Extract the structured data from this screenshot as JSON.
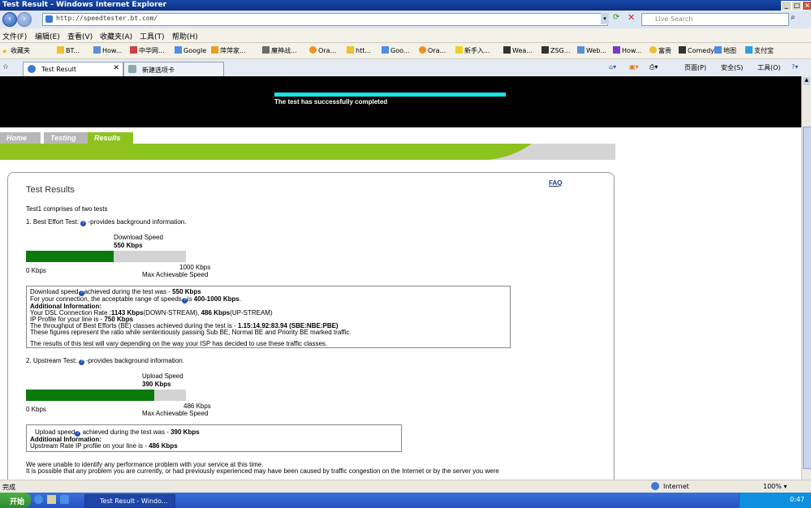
{
  "window": {
    "title": "Test Result - Windows Internet Explorer"
  },
  "addressbar": {
    "url": "http://speedtester.bt.com/",
    "search_placeholder": "Live Search"
  },
  "menu": [
    "文件(F)",
    "编辑(E)",
    "查看(V)",
    "收藏夹(A)",
    "工具(T)",
    "帮助(H)"
  ],
  "favorites": {
    "label": "收藏夹",
    "items": [
      "BT...",
      "How...",
      "中华网...",
      "Google",
      "萍萍家...",
      "魔神战...",
      "htt...",
      "Goo...",
      "Ora...",
      "htt...",
      "Goo...",
      "Ora...",
      "新手入...",
      "Wea...",
      "ZSG...",
      "Web...",
      "How...",
      "富贵",
      "Comedy",
      "地图",
      "支付宝"
    ]
  },
  "tabs": {
    "active": "Test Result",
    "new": "新建选项卡"
  },
  "toolbar": {
    "page": "页面(P)",
    "safety": "安全(S)",
    "tools": "工具(O)"
  },
  "page": {
    "progress_text": "The test has successfully completed",
    "nav": [
      {
        "label": "Home",
        "color": "#b7b7b7"
      },
      {
        "label": "Testing",
        "color": "#b7b7b7"
      },
      {
        "label": "Results",
        "color": "#8ec21f"
      }
    ],
    "faq": "FAQ",
    "heading": "Test Results",
    "intro": "Test1 comprises of two tests",
    "test1": {
      "title_pre": "1. Best Effort Test: ",
      "title_post": " -provides background information.",
      "bar_label": "Download Speed",
      "bar_value": "550 Kbps",
      "fill_fraction": 0.55,
      "min_label": "0 Kbps",
      "max_label": "1000 Kbps",
      "max_caption": "Max Achievable Speed",
      "info": {
        "l1a": "Download speed",
        "l1b": "achieved during the test was - ",
        "l1c": "550 Kbps",
        "l2a": "For your connection, the acceptable range of speeds",
        "l2b": "is ",
        "l2c": "400-1000 Kbps",
        "l2d": ".",
        "l3": "Additional Information:",
        "l4a": "Your DSL Connection Rate :",
        "l4b": "1143 Kbps",
        "l4c": "(DOWN-STREAM), ",
        "l4d": "486 Kbps",
        "l4e": "(UP-STREAM)",
        "l5a": "IP Profile for your line is - ",
        "l5b": "750 Kbps",
        "l6a": "The throughput of Best Efforts (BE) classes achieved during the test is - ",
        "l6b": "1.15:14.92:83.94 (SBE:NBE:PBE)",
        "l7": "These figures represent the ratio while sententiously passing Sub BE, Normal BE and Priority BE marked traffic.",
        "l8": "The results of this test will vary depending on the way your ISP has decided to use these traffic classes."
      }
    },
    "test2": {
      "title_pre": "2. Upstream Test: ",
      "title_post": " -provides background information.",
      "bar_label": "Upload Speed",
      "bar_value": "390 Kbps",
      "fill_fraction": 0.8,
      "min_label": "0 Kbps",
      "max_label": "486 Kbps",
      "max_caption": "Max Achievable Speed",
      "info": {
        "l1a": "Upload speed",
        "l1b": " achieved during the test was - ",
        "l1c": "390 Kbps",
        "l2": "Additional Information:",
        "l3a": "Upstream Rate IP profile on your line is - ",
        "l3b": "486 Kbps"
      }
    },
    "footer1": "We were unable to identify any performance problem with your service at this time.",
    "footer2": "It is possible that any problem you are currently, or had previously experienced may have been caused by traffic congestion on the Internet or by the server you were"
  },
  "status": {
    "left": "完成",
    "zone": "Internet",
    "zoom": "100%"
  },
  "taskbar": {
    "start": "开始",
    "item": "Test Result - Windo...",
    "clock": "0:47"
  }
}
